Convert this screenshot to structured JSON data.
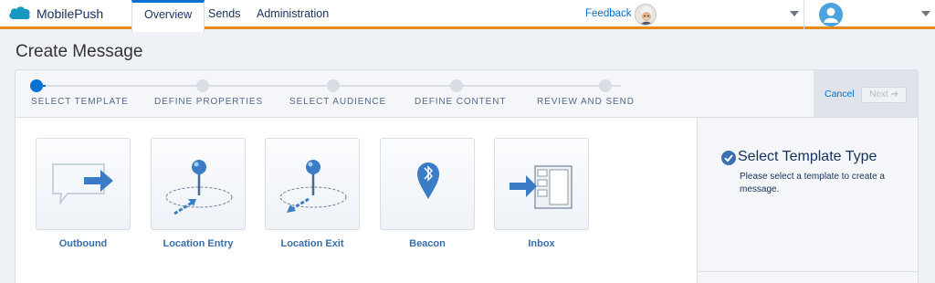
{
  "app": {
    "name": "MobilePush"
  },
  "nav": {
    "tabs": [
      {
        "label": "Overview"
      },
      {
        "label": "Sends"
      },
      {
        "label": "Administration"
      }
    ],
    "active_tab": "Overview"
  },
  "header": {
    "feedback_label": "Feedback"
  },
  "page": {
    "title": "Create Message"
  },
  "wizard": {
    "steps": [
      {
        "label": "SELECT TEMPLATE",
        "state": "current"
      },
      {
        "label": "DEFINE PROPERTIES",
        "state": "upcoming"
      },
      {
        "label": "SELECT AUDIENCE",
        "state": "upcoming"
      },
      {
        "label": "DEFINE CONTENT",
        "state": "upcoming"
      },
      {
        "label": "REVIEW AND SEND",
        "state": "upcoming"
      }
    ],
    "cancel_label": "Cancel",
    "next_label": "Next ➔"
  },
  "templates": [
    {
      "label": "Outbound",
      "icon": "outbound-icon"
    },
    {
      "label": "Location Entry",
      "icon": "location-entry-icon"
    },
    {
      "label": "Location Exit",
      "icon": "location-exit-icon"
    },
    {
      "label": "Beacon",
      "icon": "beacon-icon"
    },
    {
      "label": "Inbox",
      "icon": "inbox-icon"
    }
  ],
  "side_panel": {
    "title": "Select Template Type",
    "description": "Please select a template to create a message."
  },
  "colors": {
    "accent": "#0070d2",
    "nav_underline": "#e8881a",
    "template_icon": "#3a7cc5"
  }
}
